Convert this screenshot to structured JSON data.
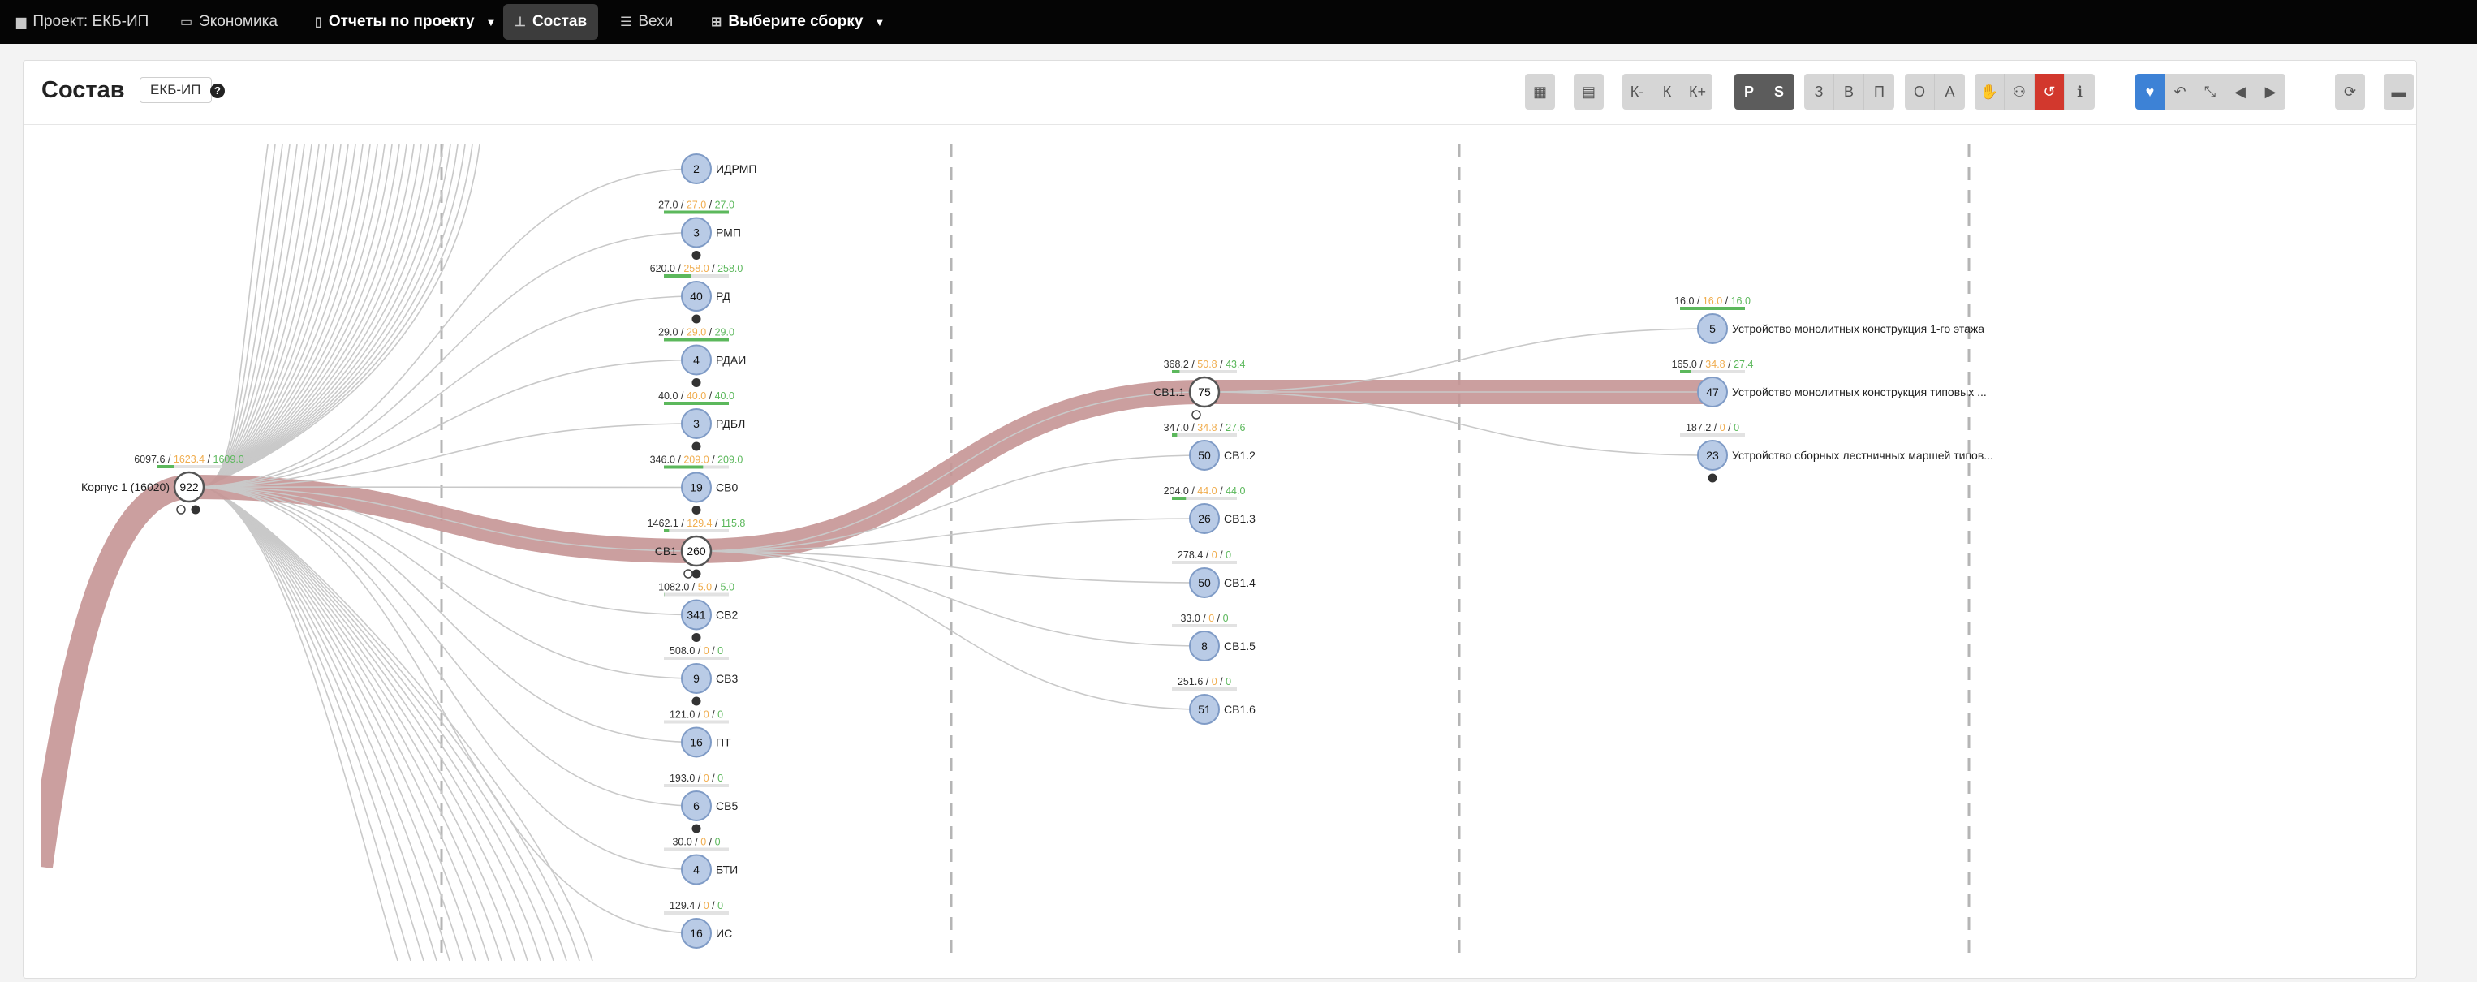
{
  "nav": {
    "project": "Проект: ЕКБ-ИП",
    "economy": "Экономика",
    "reports": "Отчеты по проекту",
    "composition": "Состав",
    "milestones": "Вехи",
    "build_select": "Выберите сборку"
  },
  "header": {
    "title": "Состав",
    "badge": "ЕКБ-ИП",
    "help": "?"
  },
  "toolbar": {
    "groups": [
      {
        "id": "calendar",
        "buttons": [
          {
            "name": "calendar-icon",
            "glyph": "▦"
          }
        ]
      },
      {
        "id": "doc",
        "buttons": [
          {
            "name": "document-icon",
            "glyph": "▤"
          }
        ]
      },
      {
        "id": "k",
        "buttons": [
          {
            "name": "k-minus-button",
            "glyph": "К-"
          },
          {
            "name": "k-button",
            "glyph": "К"
          },
          {
            "name": "k-plus-button",
            "glyph": "К+"
          }
        ]
      },
      {
        "id": "ps",
        "dark": true,
        "buttons": [
          {
            "name": "p-button",
            "glyph": "P"
          },
          {
            "name": "s-button",
            "glyph": "S"
          }
        ]
      },
      {
        "id": "zvp",
        "buttons": [
          {
            "name": "z-button",
            "glyph": "З"
          },
          {
            "name": "v-button",
            "glyph": "В"
          },
          {
            "name": "p2-button",
            "glyph": "П"
          }
        ]
      },
      {
        "id": "oa",
        "buttons": [
          {
            "name": "o-button",
            "glyph": "О"
          },
          {
            "name": "a-button",
            "glyph": "А"
          }
        ]
      },
      {
        "id": "actions",
        "buttons": [
          {
            "name": "hand-icon",
            "glyph": "✋"
          },
          {
            "name": "user-remove-icon",
            "glyph": "⚇"
          },
          {
            "name": "history-icon",
            "glyph": "↺",
            "style": "red"
          },
          {
            "name": "info-icon",
            "glyph": "ℹ"
          }
        ]
      },
      {
        "id": "view",
        "buttons": [
          {
            "name": "heart-icon",
            "glyph": "♥",
            "style": "blue"
          },
          {
            "name": "undo-icon",
            "glyph": "↶"
          },
          {
            "name": "compress-icon",
            "glyph": "⤡"
          },
          {
            "name": "prev-icon",
            "glyph": "◀"
          },
          {
            "name": "next-icon",
            "glyph": "▶"
          }
        ]
      },
      {
        "id": "refresh",
        "buttons": [
          {
            "name": "refresh-icon",
            "glyph": "⟳"
          }
        ]
      },
      {
        "id": "card",
        "buttons": [
          {
            "name": "card-icon",
            "glyph": "▬"
          }
        ]
      }
    ]
  },
  "colors": {
    "flow": "#c59595",
    "node_fill": "#b9cbe6",
    "node_stroke": "#7f9bc6",
    "green": "#5cb85c",
    "orange": "#f0ad4e",
    "line": "#c9c9c9"
  },
  "graph": {
    "root": {
      "label": "Корпус 1 (16020)",
      "count": "922",
      "stats": [
        "6097.6",
        "1623.4",
        "1609.0"
      ]
    },
    "level1": [
      {
        "label": "ИДРМП",
        "count": "2",
        "stats": [
          "",
          "",
          ""
        ]
      },
      {
        "label": "РМП",
        "count": "3",
        "stats": [
          "27.0",
          "27.0",
          "27.0"
        ],
        "info": true
      },
      {
        "label": "РД",
        "count": "40",
        "stats": [
          "620.0",
          "258.0",
          "258.0"
        ],
        "info": true
      },
      {
        "label": "РДАИ",
        "count": "4",
        "stats": [
          "29.0",
          "29.0",
          "29.0"
        ],
        "info": true
      },
      {
        "label": "РДБЛ",
        "count": "3",
        "stats": [
          "40.0",
          "40.0",
          "40.0"
        ],
        "info": true
      },
      {
        "label": "СВ0",
        "count": "19",
        "stats": [
          "346.0",
          "209.0",
          "209.0"
        ],
        "info": true
      },
      {
        "label": "СВ1",
        "count": "260",
        "stats": [
          "1462.1",
          "129.4",
          "115.8"
        ],
        "info": true,
        "selected": true
      },
      {
        "label": "СВ2",
        "count": "341",
        "stats": [
          "1082.0",
          "5.0",
          "5.0"
        ],
        "info": true
      },
      {
        "label": "СВ3",
        "count": "9",
        "stats": [
          "508.0",
          "0",
          "0"
        ],
        "info": true
      },
      {
        "label": "ПТ",
        "count": "16",
        "stats": [
          "121.0",
          "0",
          "0"
        ]
      },
      {
        "label": "СВ5",
        "count": "6",
        "stats": [
          "193.0",
          "0",
          "0"
        ],
        "info": true
      },
      {
        "label": "БТИ",
        "count": "4",
        "stats": [
          "30.0",
          "0",
          "0"
        ]
      },
      {
        "label": "ИС",
        "count": "16",
        "stats": [
          "129.4",
          "0",
          "0"
        ]
      }
    ],
    "level2": [
      {
        "label": "СВ1.1",
        "count": "75",
        "stats": [
          "368.2",
          "50.8",
          "43.4"
        ],
        "selected": true
      },
      {
        "label": "СВ1.2",
        "count": "50",
        "stats": [
          "347.0",
          "34.8",
          "27.6"
        ]
      },
      {
        "label": "СВ1.3",
        "count": "26",
        "stats": [
          "204.0",
          "44.0",
          "44.0"
        ]
      },
      {
        "label": "СВ1.4",
        "count": "50",
        "stats": [
          "278.4",
          "0",
          "0"
        ]
      },
      {
        "label": "СВ1.5",
        "count": "8",
        "stats": [
          "33.0",
          "0",
          "0"
        ]
      },
      {
        "label": "СВ1.6",
        "count": "51",
        "stats": [
          "251.6",
          "0",
          "0"
        ]
      }
    ],
    "level3": [
      {
        "label": "Устройство монолитных конструкция 1-го этажа",
        "count": "5",
        "stats": [
          "16.0",
          "16.0",
          "16.0"
        ]
      },
      {
        "label": "Устройство монолитных конструкция типовых ...",
        "count": "47",
        "stats": [
          "165.0",
          "34.8",
          "27.4"
        ],
        "selected": true
      },
      {
        "label": "Устройство сборных лестничных маршей типов...",
        "count": "23",
        "stats": [
          "187.2",
          "0",
          "0"
        ],
        "info": true
      }
    ]
  }
}
